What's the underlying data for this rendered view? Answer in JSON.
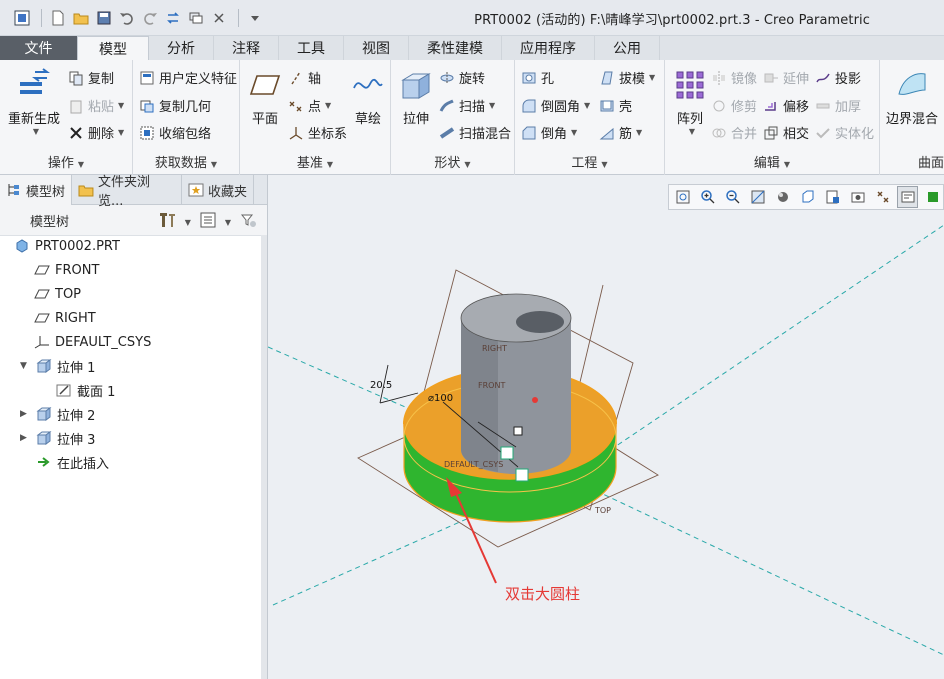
{
  "window": {
    "title": "PRT0002 (活动的) F:\\晴峰学习\\prt0002.prt.3 - Creo Parametric"
  },
  "tabs": [
    "文件",
    "模型",
    "分析",
    "注释",
    "工具",
    "视图",
    "柔性建模",
    "应用程序",
    "公用"
  ],
  "active_tab": "模型",
  "ribbon": {
    "ops": {
      "regen": "重新生成",
      "copy": "复制",
      "paste": "粘贴",
      "delete": "删除",
      "label": "操作"
    },
    "getdata": {
      "udf": "用户定义特征",
      "copygeom": "复制几何",
      "shrinkwrap": "收缩包络",
      "label": "获取数据"
    },
    "datum": {
      "plane": "平面",
      "axis": "轴",
      "point": "点",
      "csys": "坐标系",
      "sketch": "草绘",
      "label": "基准"
    },
    "shapes": {
      "extrude": "拉伸",
      "revolve": "旋转",
      "sweep": "扫描",
      "swept_blend": "扫描混合",
      "label": "形状"
    },
    "engineering": {
      "hole": "孔",
      "round": "倒圆角",
      "chamfer": "倒角",
      "draft": "拔模",
      "shell": "壳",
      "rib": "筋",
      "label": "工程"
    },
    "editing": {
      "pattern": "阵列",
      "mirror": "镜像",
      "trim": "修剪",
      "merge": "合并",
      "extend": "延伸",
      "offset": "偏移",
      "intersect": "相交",
      "project": "投影",
      "thicken": "加厚",
      "solidify": "实体化",
      "label": "编辑"
    },
    "surfaces": {
      "boundary_blend": "边界混合",
      "label": "曲面"
    }
  },
  "panel": {
    "tabs": [
      "模型树",
      "文件夹浏览...",
      "收藏夹"
    ],
    "header": "模型树",
    "tree": [
      {
        "label": "PRT0002.PRT",
        "icon": "part-icon"
      },
      {
        "label": "FRONT",
        "icon": "datum-plane-icon"
      },
      {
        "label": "TOP",
        "icon": "datum-plane-icon"
      },
      {
        "label": "RIGHT",
        "icon": "datum-plane-icon"
      },
      {
        "label": "DEFAULT_CSYS",
        "icon": "csys-icon"
      },
      {
        "label": "拉伸 1",
        "icon": "extrude-icon"
      },
      {
        "label": "截面 1",
        "icon": "section-icon"
      },
      {
        "label": "拉伸 2",
        "icon": "extrude-icon"
      },
      {
        "label": "拉伸 3",
        "icon": "extrude-icon"
      },
      {
        "label": "在此插入",
        "icon": "insert-arrow-icon"
      }
    ]
  },
  "model": {
    "dims": [
      "20.5",
      "⌀100"
    ],
    "datum_labels": [
      "RIGHT",
      "FRONT",
      "DEFAULT_CSYS",
      "TOP"
    ],
    "annotation": "双击大圆柱",
    "colors": {
      "selected_highlight": "#f0a020",
      "base_cylinder": "#2db52d",
      "boss": "#8f949c",
      "annotation": "#e53935"
    }
  }
}
